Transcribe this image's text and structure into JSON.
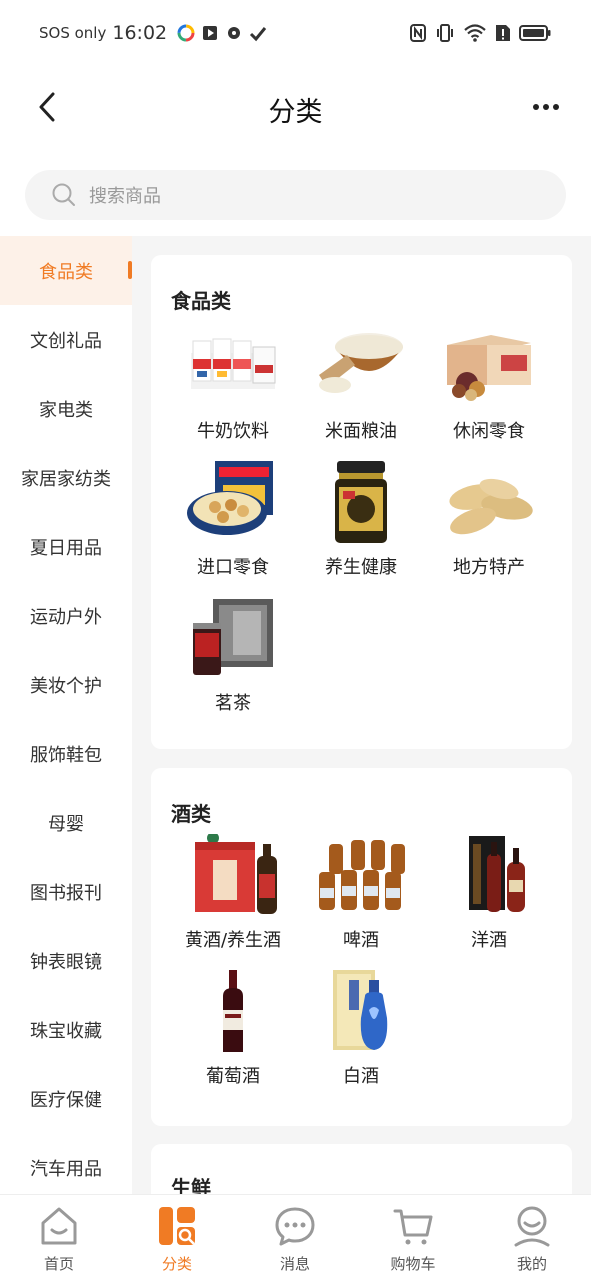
{
  "status_bar": {
    "carrier": "SOS only",
    "time": "16:02"
  },
  "header": {
    "title": "分类"
  },
  "search": {
    "placeholder": "搜索商品"
  },
  "sidebar": {
    "items": [
      {
        "label": "食品类"
      },
      {
        "label": "文创礼品"
      },
      {
        "label": "家电类"
      },
      {
        "label": "家居家纺类"
      },
      {
        "label": "夏日用品"
      },
      {
        "label": "运动户外"
      },
      {
        "label": "美妆个护"
      },
      {
        "label": "服饰鞋包"
      },
      {
        "label": "母婴"
      },
      {
        "label": "图书报刊"
      },
      {
        "label": "钟表眼镜"
      },
      {
        "label": "珠宝收藏"
      },
      {
        "label": "医疗保健"
      },
      {
        "label": "汽车用品"
      }
    ],
    "active_index": 0
  },
  "sections": [
    {
      "title": "食品类",
      "items": [
        {
          "label": "牛奶饮料",
          "icon": "milk-box-image"
        },
        {
          "label": "米面粮油",
          "icon": "rice-bowl-image"
        },
        {
          "label": "休闲零食",
          "icon": "snack-box-image"
        },
        {
          "label": "进口零食",
          "icon": "cookie-tin-image"
        },
        {
          "label": "养生健康",
          "icon": "health-jar-image"
        },
        {
          "label": "地方特产",
          "icon": "peanuts-image"
        },
        {
          "label": "茗茶",
          "icon": "tea-box-image"
        }
      ]
    },
    {
      "title": "酒类",
      "items": [
        {
          "label": "黄酒/养生酒",
          "icon": "yellow-wine-image"
        },
        {
          "label": "啤酒",
          "icon": "beer-bottles-image"
        },
        {
          "label": "洋酒",
          "icon": "cognac-image"
        },
        {
          "label": "葡萄酒",
          "icon": "red-wine-image"
        },
        {
          "label": "白酒",
          "icon": "baijiu-image"
        }
      ]
    },
    {
      "title": "生鲜",
      "items": []
    }
  ],
  "tab_bar": {
    "tabs": [
      {
        "label": "首页",
        "icon": "home-icon"
      },
      {
        "label": "分类",
        "icon": "category-icon"
      },
      {
        "label": "消息",
        "icon": "message-icon"
      },
      {
        "label": "购物车",
        "icon": "cart-icon"
      },
      {
        "label": "我的",
        "icon": "profile-icon"
      }
    ],
    "active_index": 1
  },
  "colors": {
    "accent": "#f07b24",
    "active_bg": "#fdf1e8",
    "panel_bg": "#f5f5f5"
  }
}
